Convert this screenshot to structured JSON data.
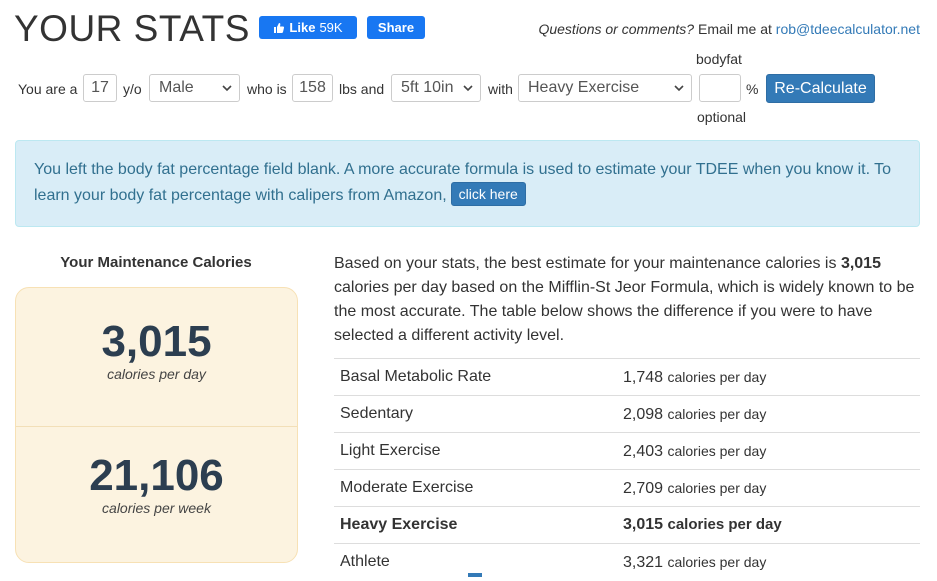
{
  "header": {
    "title": "YOUR STATS",
    "fb_like_label": "Like",
    "fb_like_count": "59K",
    "fb_share_label": "Share",
    "contact_italic": "Questions or comments?",
    "contact_text": "Email me at",
    "contact_email": "rob@tdeecalculator.net"
  },
  "form": {
    "you_are_a": "You are a",
    "age": "17",
    "yo": "y/o",
    "gender": "Male",
    "who_is": "who is",
    "weight": "158",
    "lbs_and": "lbs and",
    "height": "5ft 10in",
    "with": "with",
    "activity": "Heavy Exercise",
    "bodyfat_label": "bodyfat",
    "bodyfat_value": "",
    "percent": "%",
    "optional": "optional",
    "recalc_label": "Re-Calculate"
  },
  "alert": {
    "text": "You left the body fat percentage field blank. A more accurate formula is used to estimate your TDEE when you know it. To learn your body fat percentage with calipers from Amazon,",
    "button_label": "click here"
  },
  "maintenance": {
    "title": "Your Maintenance Calories",
    "daily_value": "3,015",
    "daily_label": "calories per day",
    "weekly_value": "21,106",
    "weekly_label": "calories per week"
  },
  "description": {
    "part1": "Based on your stats, the best estimate for your maintenance calories is",
    "bold_value": "3,015",
    "part2": "calories per day based on the Mifflin-St Jeor Formula, which is widely known to be the most accurate. The table below shows the difference if you were to have selected a different activity level."
  },
  "activity_table": {
    "unit": "calories per day",
    "rows": [
      {
        "label": "Basal Metabolic Rate",
        "value": "1,748"
      },
      {
        "label": "Sedentary",
        "value": "2,098"
      },
      {
        "label": "Light Exercise",
        "value": "2,403"
      },
      {
        "label": "Moderate Exercise",
        "value": "2,709"
      },
      {
        "label": "Heavy Exercise",
        "value": "3,015"
      },
      {
        "label": "Athlete",
        "value": "3,321"
      }
    ]
  },
  "colors": {
    "primary": "#337ab7",
    "facebook": "#1877f2",
    "alert_bg": "#d9edf7",
    "alert_text": "#31708f",
    "card_bg": "#fcf3e0",
    "number": "#2c3e50"
  }
}
